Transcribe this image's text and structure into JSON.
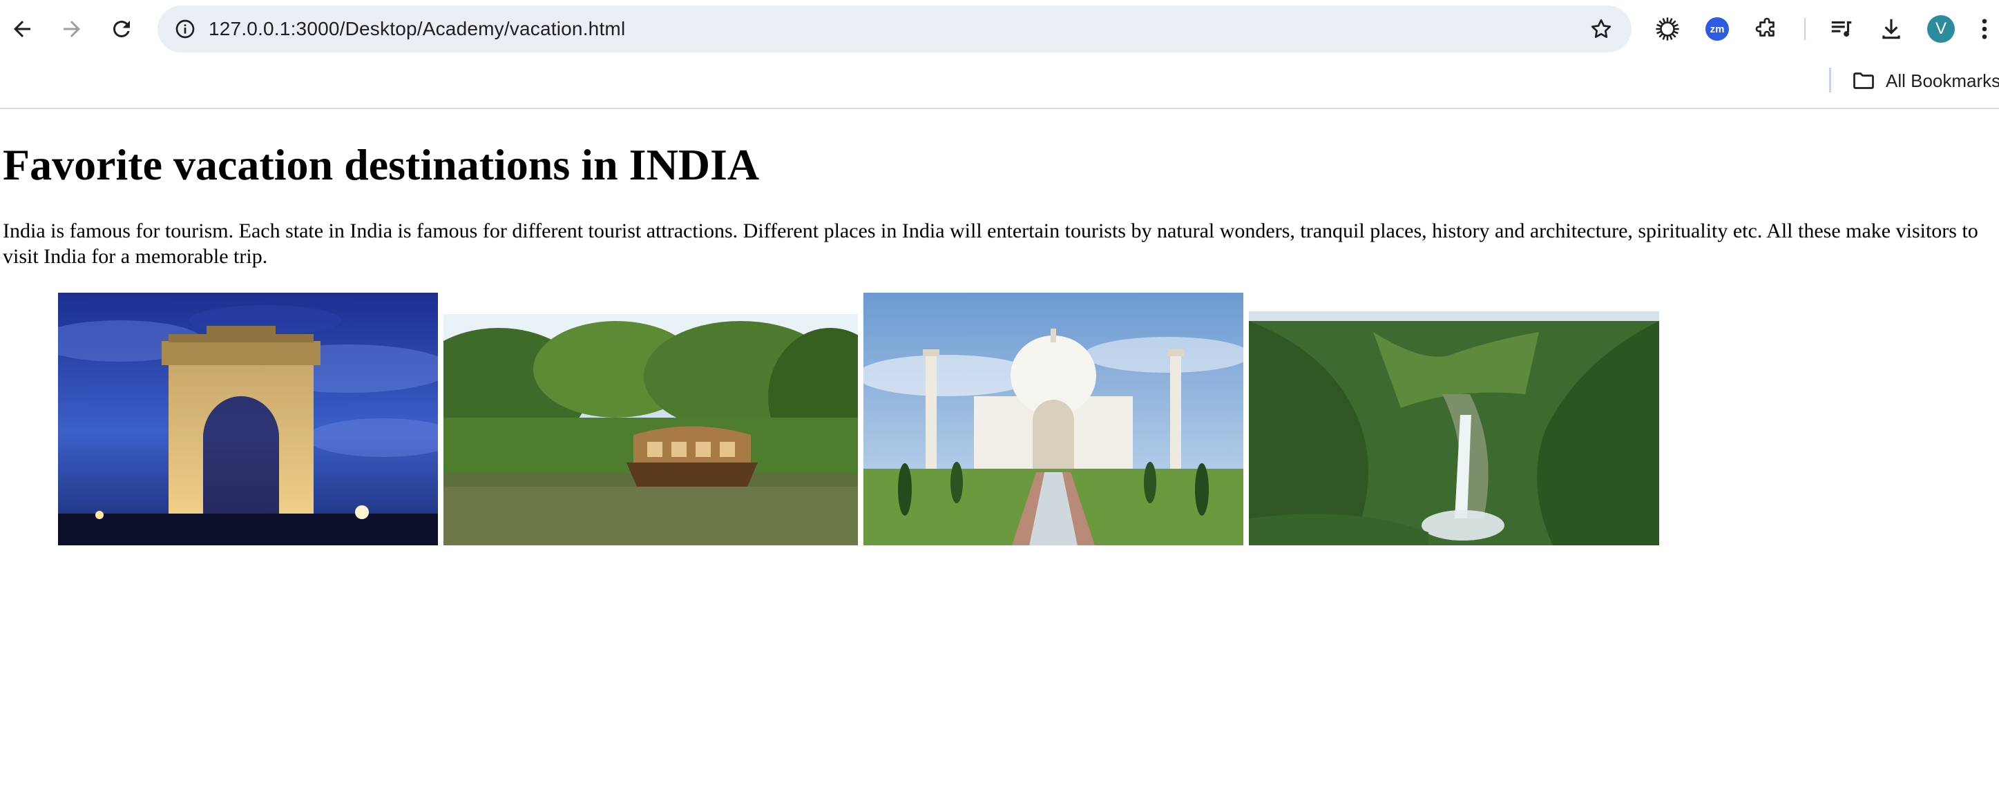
{
  "browser": {
    "url": "127.0.0.1:3000/Desktop/Academy/vacation.html",
    "profile_initial": "V",
    "extension_zoom_label": "zm",
    "bookmarks_label": "All Bookmarks",
    "icons": [
      "back-arrow-icon",
      "forward-arrow-icon",
      "reload-icon",
      "site-info-icon",
      "bookmark-star-icon",
      "sun-extension-icon",
      "zoom-extension-icon",
      "extensions-puzzle-icon",
      "reading-list-icon",
      "download-icon",
      "menu-dots-icon",
      "folder-icon"
    ]
  },
  "page": {
    "heading": "Favorite vacation destinations in INDIA",
    "intro": "India is famous for tourism. Each state in India is famous for different tourist attractions. Different places in India will entertain tourists by natural wonders, tranquil places, history and architecture, spirituality etc. All these make visitors to visit India for a memorable trip."
  },
  "colors": {
    "omnibox": "#eaeef5",
    "profile_avatar": "#2d8c9c",
    "zoom_extension": "#2d5be3"
  }
}
